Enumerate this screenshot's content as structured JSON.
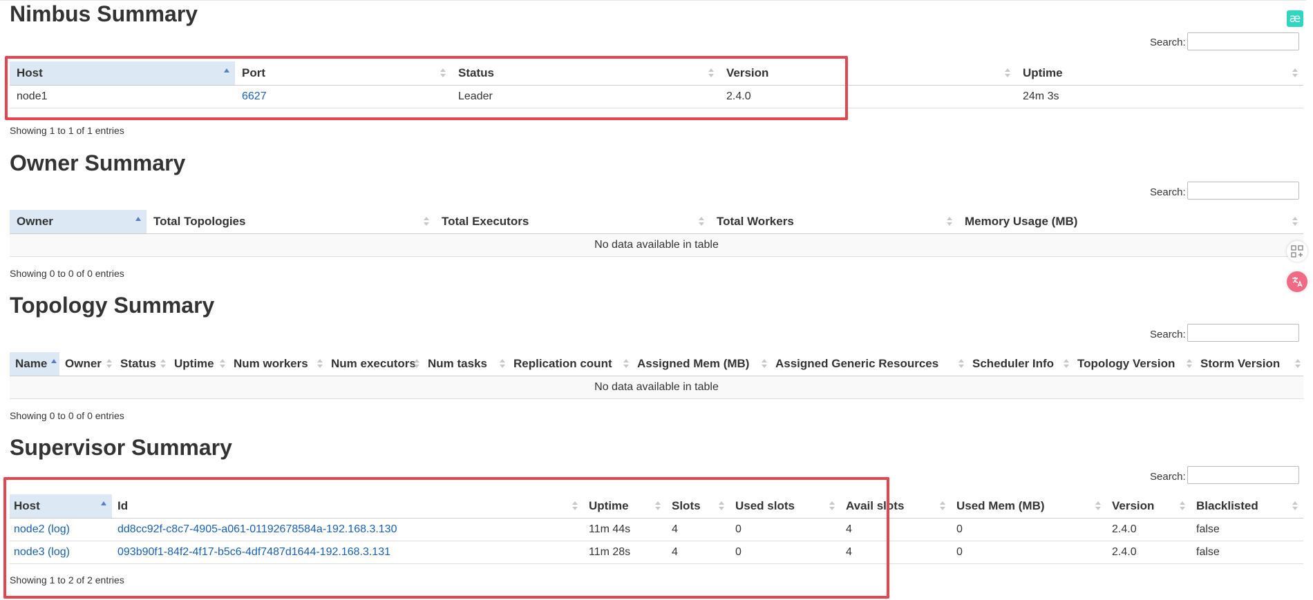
{
  "search_label": "Search:",
  "nimbus": {
    "title": "Nimbus Summary",
    "columns": [
      "Host",
      "Port",
      "Status",
      "Version",
      "Uptime"
    ],
    "rows": [
      {
        "host": "node1",
        "port": "6627",
        "status": "Leader",
        "version": "2.4.0",
        "uptime": "24m 3s"
      }
    ],
    "info": "Showing 1 to 1 of 1 entries"
  },
  "owner": {
    "title": "Owner Summary",
    "columns": [
      "Owner",
      "Total Topologies",
      "Total Executors",
      "Total Workers",
      "Memory Usage (MB)"
    ],
    "empty": "No data available in table",
    "info": "Showing 0 to 0 of 0 entries"
  },
  "topology": {
    "title": "Topology Summary",
    "columns": [
      "Name",
      "Owner",
      "Status",
      "Uptime",
      "Num workers",
      "Num executors",
      "Num tasks",
      "Replication count",
      "Assigned Mem (MB)",
      "Assigned Generic Resources",
      "Scheduler Info",
      "Topology Version",
      "Storm Version"
    ],
    "empty": "No data available in table",
    "info": "Showing 0 to 0 of 0 entries"
  },
  "supervisor": {
    "title": "Supervisor Summary",
    "columns": [
      "Host",
      "Id",
      "Uptime",
      "Slots",
      "Used slots",
      "Avail slots",
      "Used Mem (MB)",
      "Version",
      "Blacklisted"
    ],
    "rows": [
      {
        "host": "node2",
        "log": "(log)",
        "id": "dd8cc92f-c8c7-4905-a061-01192678584a-192.168.3.130",
        "uptime": "11m 44s",
        "slots": "4",
        "used_slots": "0",
        "avail_slots": "4",
        "used_mem": "0",
        "version": "2.4.0",
        "blacklisted": "false"
      },
      {
        "host": "node3",
        "log": "(log)",
        "id": "093b90f1-84f2-4f17-b5c6-4df7487d1644-192.168.3.131",
        "uptime": "11m 28s",
        "slots": "4",
        "used_slots": "0",
        "avail_slots": "4",
        "used_mem": "0",
        "version": "2.4.0",
        "blacklisted": "false"
      }
    ],
    "info": "Showing 1 to 2 of 2 entries"
  },
  "icons": {
    "extension": "ae-icon",
    "apps": "apps-grid-icon",
    "translate": "translate-icon"
  },
  "colors": {
    "link": "#1a5fb4",
    "sorted_header": "#dce9f5",
    "highlight": "#e5454f",
    "extension_icon": "#2fd6c0"
  }
}
